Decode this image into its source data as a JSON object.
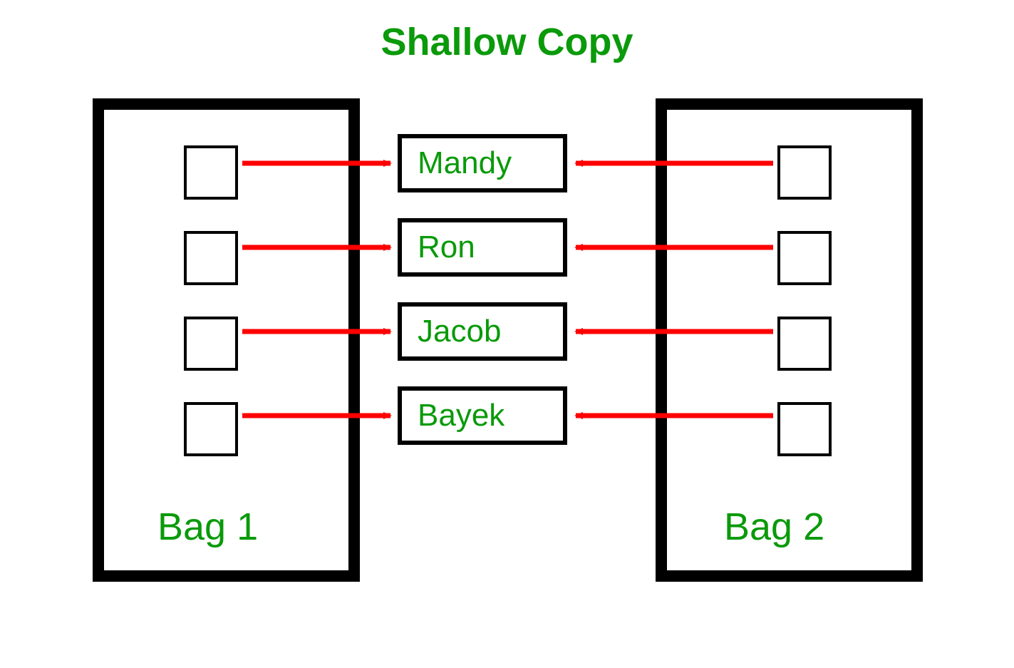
{
  "title": "Shallow Copy",
  "bag1": {
    "label": "Bag 1",
    "slots": 4
  },
  "bag2": {
    "label": "Bag 2",
    "slots": 4
  },
  "names": [
    "Mandy",
    "Ron",
    "Jacob",
    "Bayek"
  ],
  "colors": {
    "text_green": "#0a9a0a",
    "arrow_red": "#ff0000",
    "border_black": "#000000"
  }
}
